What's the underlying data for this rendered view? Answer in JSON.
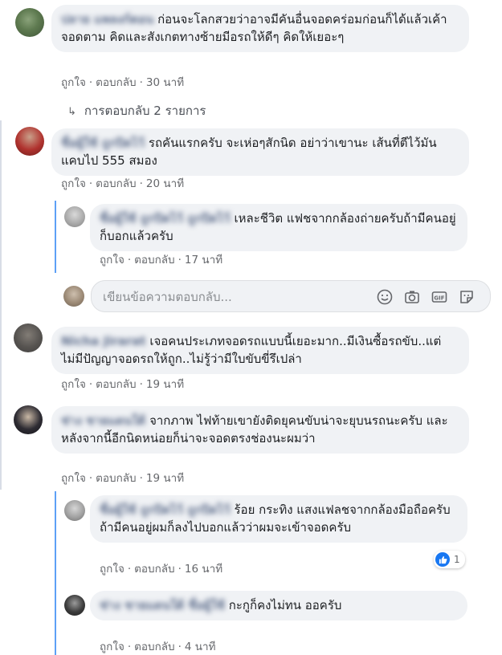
{
  "comments": [
    {
      "author": "ปลาย แพลงก์ตอน",
      "text": "ก่อนจะโลกสวยว่าอาจมีคันอื่นจอดคร่อมก่อนก็ได้แล้วเค้าจอดตาม คิดและสังเกตทางซ้ายมีอรถให้ดีๆ คิดให้เยอะๆ",
      "like": "ถูกใจ",
      "reply": "ตอบกลับ",
      "time": "30 นาที"
    },
    {
      "author": "ชื่อผู้ใช้ ถูกปิดไว้",
      "text": "รถคันแรกครับ จะเห่อๆสักนิด อย่าว่าเขานะ เส้นที่ตีไว้มันแคบไป 555 สมอง",
      "like": "ถูกใจ",
      "reply": "ตอบกลับ",
      "time": "20 นาที"
    },
    {
      "author": "Nicha Jirarat",
      "text": "เจอคนประเภทจอดรถแบบนี้เยอะมาก..มีเงินซื้อรถขับ..แต่ไม่มีปัญญาจอดรถให้ถูก..ไม่รู้ว่ามีใบขับขี่รึเปล่า",
      "like": "ถูกใจ",
      "reply": "ตอบกลับ",
      "time": "19 นาที"
    },
    {
      "author": "ช่าง ชายแดนใต้",
      "text": "จากภาพ ไฟท้ายเขายังติดยุคนขับน่าจะยุบนรถนะครับ และหลังจากนี้อีกนิดหน่อยก็น่าจะจอดตรงช่องนะผมว่า",
      "like": "ถูกใจ",
      "reply": "ตอบกลับ",
      "time": "19 นาที"
    }
  ],
  "replies": [
    {
      "author": "ชื่อผู้ใช้ ถูกปิดไว้ ถูกปิดไว้",
      "text": "เหละชีวิต แฟชจากกล้องถ่ายครับถ้ามีคนอยู่ก็บอกแล้วครับ",
      "like": "ถูกใจ",
      "reply": "ตอบกลับ",
      "time": "17 นาที"
    },
    {
      "author": "ชื่อผู้ใช้ ถูกปิดไว้ ถูกปิดไว้",
      "text": "ร้อย กระทิง แสงแฟลชจากกล้องมือถือครับถ้ามีคนอยู่ผมก็ลงไปบอกแล้วว่าผมจะเข้าจอดครับ",
      "like": "ถูกใจ",
      "reply": "ตอบกลับ",
      "time": "16 นาที",
      "reaction_count": "1"
    },
    {
      "author": "ช่าง ชายแดนใต้ ชื่อผู้ใช้",
      "text": "กะกูก็คงไม่ทน ออครับ",
      "like": "ถูกใจ",
      "reply": "ตอบกลับ",
      "time": "4 นาที"
    }
  ],
  "view_replies": {
    "label": "การตอบกลับ 2 รายการ"
  },
  "reply_box": {
    "placeholder": "เขียนข้อความตอบกลับ..."
  },
  "colors": {
    "bubble": "#f0f2f5",
    "link_blue": "#1877f2",
    "muted": "#65676b"
  }
}
